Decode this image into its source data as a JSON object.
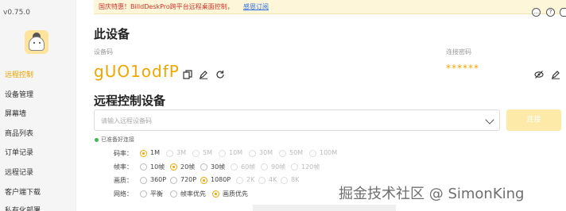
{
  "app": {
    "version": "v0.75.0"
  },
  "sidebar": {
    "items": [
      {
        "label": "远程控制",
        "active": true
      },
      {
        "label": "设备管理"
      },
      {
        "label": "屏幕墙"
      },
      {
        "label": "商品列表"
      },
      {
        "label": "订单记录"
      },
      {
        "label": "远程记录"
      },
      {
        "label": "客户端下载"
      },
      {
        "label": "私有化部署"
      }
    ]
  },
  "banner": {
    "text": "国庆特惠！BilldDeskPro跨平台远程桌面控制，",
    "link": "感恩订阅"
  },
  "topbar": {
    "icons": [
      "chat-icon",
      "help-icon",
      "settings-icon"
    ]
  },
  "this_device": {
    "title": "此设备",
    "code_label": "设备码",
    "code": "gUO1odfP",
    "password_label": "连接密码",
    "password_masked": "******"
  },
  "remote": {
    "title": "远程控制设备",
    "input_placeholder": "请输入远程设备码",
    "input_value": "",
    "connect_label": "连接",
    "status": "已准备好连接"
  },
  "options": {
    "bitrate": {
      "label": "码率：",
      "items": [
        {
          "text": "1M",
          "checked": true
        },
        {
          "text": "3M",
          "disabled": true
        },
        {
          "text": "5M",
          "disabled": true
        },
        {
          "text": "10M",
          "disabled": true
        },
        {
          "text": "30M",
          "disabled": true
        },
        {
          "text": "50M",
          "disabled": true
        },
        {
          "text": "100M",
          "disabled": true
        }
      ]
    },
    "fps": {
      "label": "帧率：",
      "items": [
        {
          "text": "10帧"
        },
        {
          "text": "20帧",
          "checked": true
        },
        {
          "text": "30帧"
        },
        {
          "text": "60帧",
          "disabled": true
        },
        {
          "text": "90帧",
          "disabled": true
        },
        {
          "text": "120帧",
          "disabled": true
        }
      ]
    },
    "resolution": {
      "label": "画质：",
      "items": [
        {
          "text": "360P"
        },
        {
          "text": "720P"
        },
        {
          "text": "1080P",
          "checked": true
        },
        {
          "text": "2K",
          "disabled": true
        },
        {
          "text": "4K",
          "disabled": true
        },
        {
          "text": "8K",
          "disabled": true
        }
      ]
    },
    "network": {
      "label": "网络：",
      "items": [
        {
          "text": "平衡"
        },
        {
          "text": "帧率优先"
        },
        {
          "text": "画质优先",
          "checked": true
        }
      ]
    }
  },
  "watermark": "掘金技术社区 @ SimonKing",
  "colors": {
    "accent": "#f0a500",
    "banner_bg": "#fdf6d9",
    "banner_text": "#d0342c",
    "link": "#2f6fde"
  }
}
